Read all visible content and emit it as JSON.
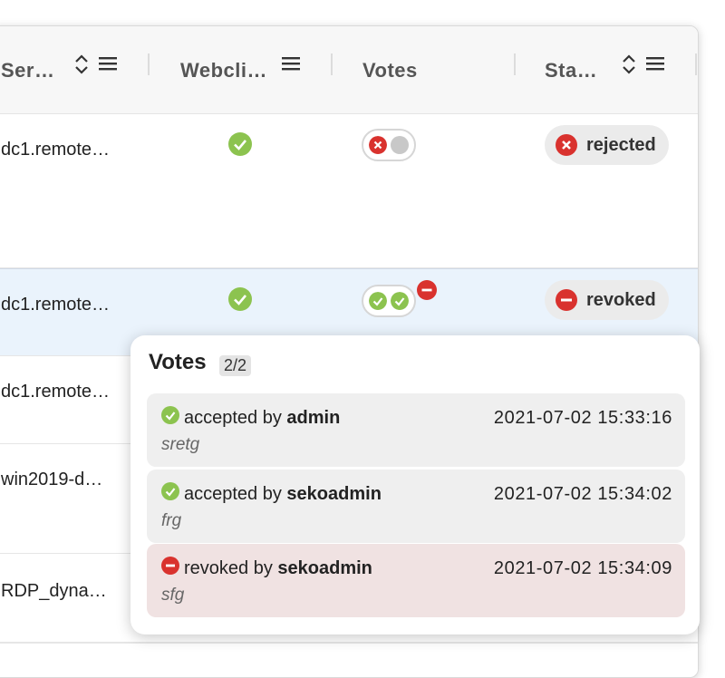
{
  "header": {
    "columns": [
      {
        "label": "Ser…",
        "sortable": true,
        "menu": true
      },
      {
        "label": "Webcli…",
        "sortable": false,
        "menu": true
      },
      {
        "label": "Votes",
        "sortable": false,
        "menu": false
      },
      {
        "label": "Sta…",
        "sortable": true,
        "menu": true
      }
    ]
  },
  "rows": [
    {
      "server": "dc1.remote…",
      "webclient": "check",
      "votes": [
        "rejected",
        "pending"
      ],
      "status": "rejected"
    },
    {
      "server": "dc1.remote…",
      "webclient": "check",
      "votes": [
        "accepted",
        "accepted"
      ],
      "vote_badge": "revoked",
      "status": "revoked"
    },
    {
      "server": "dc1.remote…"
    },
    {
      "server": "win2019-d…"
    },
    {
      "server": "RDP_dyna…"
    }
  ],
  "popover": {
    "title": "Votes",
    "count": "2/2",
    "items": [
      {
        "type": "accepted",
        "action": "accepted by",
        "user": "admin",
        "time": "2021-07-02 15:33:16",
        "comment": "sretg"
      },
      {
        "type": "accepted",
        "action": "accepted by",
        "user": "sekoadmin",
        "time": "2021-07-02 15:34:02",
        "comment": "frg"
      },
      {
        "type": "revoked",
        "action": "revoked by",
        "user": "sekoadmin",
        "time": "2021-07-02 15:34:09",
        "comment": "sfg"
      }
    ]
  },
  "colors": {
    "green": "#8cc34f",
    "red": "#d9322e",
    "grey": "#c8c8c8"
  }
}
